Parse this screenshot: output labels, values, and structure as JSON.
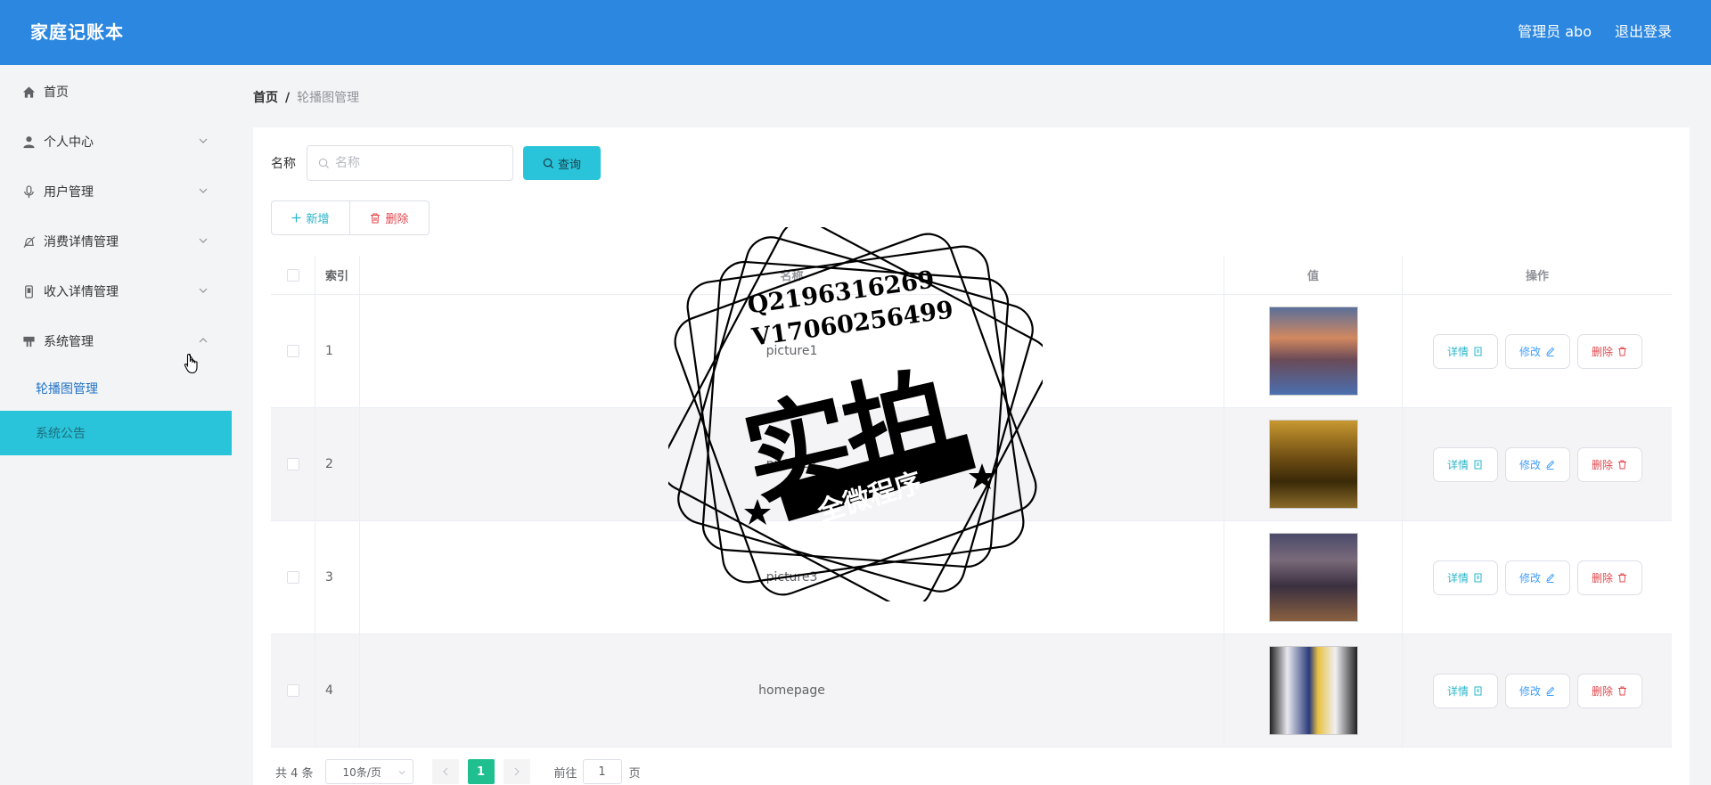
{
  "header": {
    "brand": "家庭记账本",
    "user": "管理员 abo",
    "logout": "退出登录"
  },
  "sidebar": {
    "items": [
      {
        "label": "首页",
        "icon": "home-icon"
      },
      {
        "label": "个人中心",
        "icon": "user-icon"
      },
      {
        "label": "用户管理",
        "icon": "microphone-icon"
      },
      {
        "label": "消费详情管理",
        "icon": "bell-off-icon"
      },
      {
        "label": "收入详情管理",
        "icon": "phone-icon"
      },
      {
        "label": "系统管理",
        "icon": "cabinet-icon"
      }
    ],
    "sub_items": [
      {
        "label": "轮播图管理"
      },
      {
        "label": "系统公告"
      }
    ]
  },
  "breadcrumb": {
    "home": "首页",
    "separator": "/",
    "current": "轮播图管理"
  },
  "search": {
    "label": "名称",
    "placeholder": "名称",
    "button": "查询"
  },
  "actions": {
    "add": "新增",
    "delete": "删除"
  },
  "table": {
    "headers": {
      "index": "索引",
      "name": "名称",
      "value": "值",
      "ops": "操作"
    },
    "rows": [
      {
        "index": "1",
        "name": "picture1"
      },
      {
        "index": "2",
        "name": "picture2"
      },
      {
        "index": "3",
        "name": "picture3"
      },
      {
        "index": "4",
        "name": "homepage"
      }
    ],
    "op_labels": {
      "detail": "详情",
      "edit": "修改",
      "remove": "删除"
    }
  },
  "pagination": {
    "total": "共 4 条",
    "page_size": "10条/页",
    "current_page": "1",
    "goto_label": "前往",
    "goto_value": "1",
    "goto_unit": "页"
  },
  "watermark": {
    "line1": "Q2196316269",
    "line2": "V17060256499",
    "big": "实拍",
    "banner": "全微程序"
  },
  "colors": {
    "header": "#2b87df",
    "accent": "#29c4d9",
    "danger": "#e0474d",
    "page_active": "#1fbf8f"
  }
}
